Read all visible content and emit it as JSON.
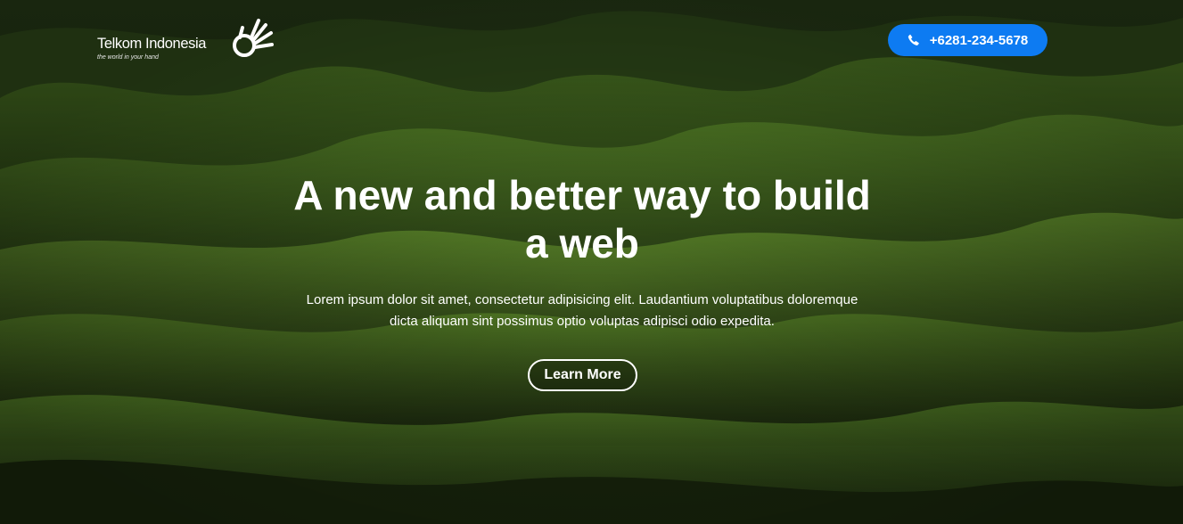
{
  "brand": {
    "name": "Telkom Indonesia",
    "tagline": "the world in your hand",
    "logo_icon": "telkom-hand-icon",
    "logo_color": "#ffffff"
  },
  "header": {
    "phone_label": "+6281-234-5678",
    "phone_icon": "phone-icon",
    "phone_button_color": "#0d7bf2"
  },
  "hero": {
    "title": "A new and better way to build a web",
    "description": "Lorem ipsum dolor sit amet, consectetur adipisicing elit. Laudantium voluptatibus doloremque dicta aliquam sint possimus optio voluptas adipisci odio expedita.",
    "cta_label": "Learn More"
  },
  "background": {
    "description_color_dark": "#1c2a12",
    "description_color_light": "#5f8f2a"
  }
}
